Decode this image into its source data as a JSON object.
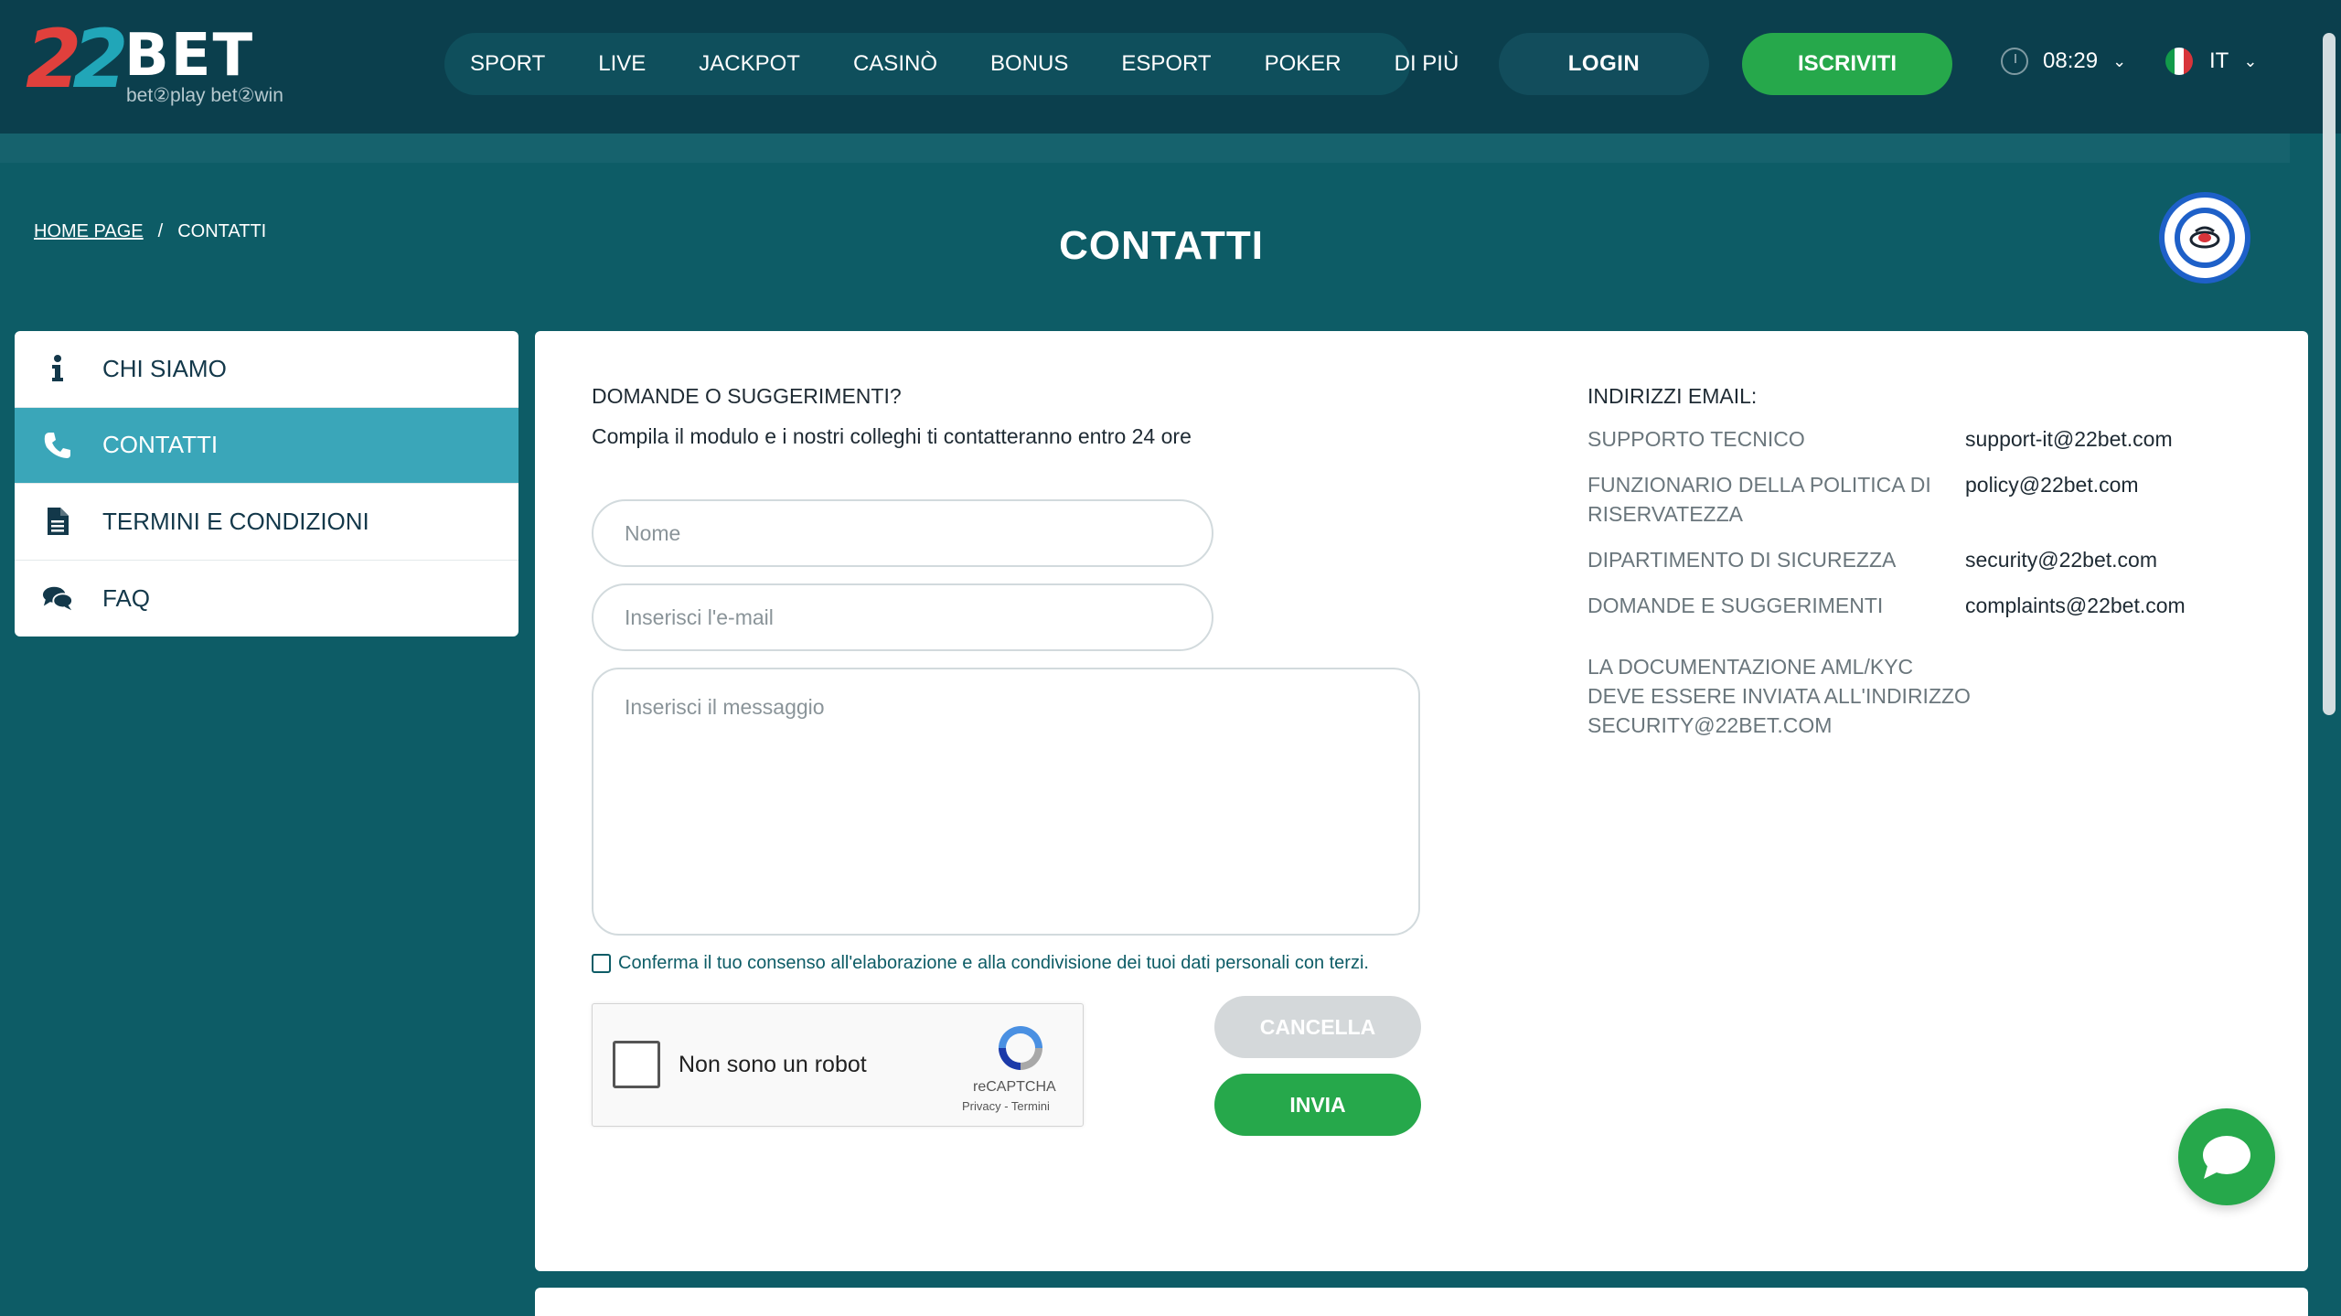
{
  "header": {
    "logo": {
      "brand": "22BET",
      "digits": "22",
      "word": "BET",
      "tagline": "bet②play  bet②win"
    },
    "nav": [
      "SPORT",
      "LIVE",
      "JACKPOT",
      "CASINÒ",
      "BONUS",
      "ESPORT",
      "POKER",
      "DI PIÙ"
    ],
    "login_label": "LOGIN",
    "register_label": "ISCRIVITI",
    "time": "08:29",
    "language": "IT",
    "colors": {
      "header_bg": "#0b3f4d",
      "accent_green": "#26a84b",
      "page_bg": "#0d5c66"
    }
  },
  "breadcrumb": {
    "home": "HOME PAGE",
    "separator": "/",
    "current": "CONTATTI"
  },
  "page_title": "CONTATTI",
  "sidebar": {
    "items": [
      {
        "label": "CHI SIAMO",
        "icon": "info-icon",
        "active": false
      },
      {
        "label": "CONTATTI",
        "icon": "phone-icon",
        "active": true
      },
      {
        "label": "TERMINI E CONDIZIONI",
        "icon": "document-icon",
        "active": false
      },
      {
        "label": "FAQ",
        "icon": "chat-bubbles-icon",
        "active": false
      }
    ],
    "active_color": "#3aa6b9"
  },
  "form": {
    "heading": "DOMANDE O SUGGERIMENTI?",
    "subtitle": "Compila il modulo e i nostri colleghi ti contatteranno entro 24 ore",
    "name_placeholder": "Nome",
    "email_placeholder": "Inserisci l'e-mail",
    "message_placeholder": "Inserisci il messaggio",
    "consent_text": "Conferma il tuo consenso all'elaborazione e alla condivisione dei tuoi dati personali con terzi.",
    "captcha": {
      "label": "Non sono un robot",
      "brand": "reCAPTCHA",
      "links": "Privacy - Termini"
    },
    "cancel_label": "CANCELLA",
    "send_label": "INVIA"
  },
  "emails": {
    "heading": "INDIRIZZI EMAIL:",
    "rows": [
      {
        "label": "SUPPORTO TECNICO",
        "value": "support-it@22bet.com"
      },
      {
        "label": "FUNZIONARIO DELLA POLITICA DI RISERVATEZZA",
        "value": "policy@22bet.com"
      },
      {
        "label": "DIPARTIMENTO DI SICUREZZA",
        "value": "security@22bet.com"
      },
      {
        "label": "DOMANDE E SUGGERIMENTI",
        "value": "complaints@22bet.com"
      }
    ],
    "aml_note": "LA DOCUMENTAZIONE AML/KYC DEVE ESSERE INVIATA ALL'INDIRIZZO SECURITY@22BET.COM"
  },
  "icons": {
    "clock": "clock-icon",
    "flag": "italy-flag-icon",
    "badge": "18-plus-badge-icon",
    "chat": "live-chat-icon"
  }
}
